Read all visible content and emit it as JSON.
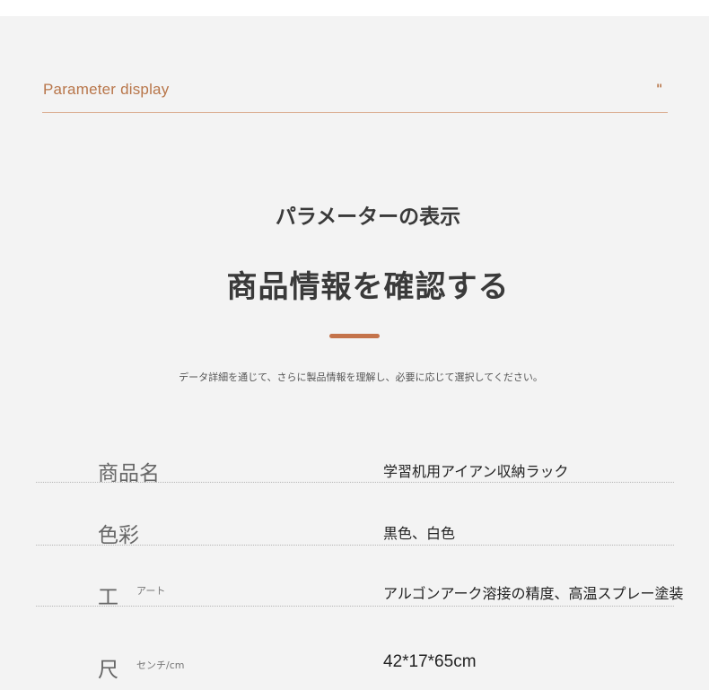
{
  "header": {
    "title": "Parameter display",
    "mark": "\"",
    "accent_color": "#c4734a"
  },
  "headings": {
    "sub": "パラメーターの表示",
    "main": "商品情報を確認する"
  },
  "description": "データ詳細を通じて、さらに製品情報を理解し、必要に応じて選択してください。",
  "specs": [
    {
      "label": "商品名",
      "sublabel": "",
      "value": "学習机用アイアン収納ラック"
    },
    {
      "label": "色彩",
      "sublabel": "",
      "value": "黒色、白色"
    },
    {
      "label": "工",
      "sublabel": "アート",
      "value": "アルゴンアーク溶接の精度、高温スプレー塗装"
    },
    {
      "label": "尺",
      "sublabel": "センチ/cm",
      "value": "42*17*65cm"
    }
  ]
}
